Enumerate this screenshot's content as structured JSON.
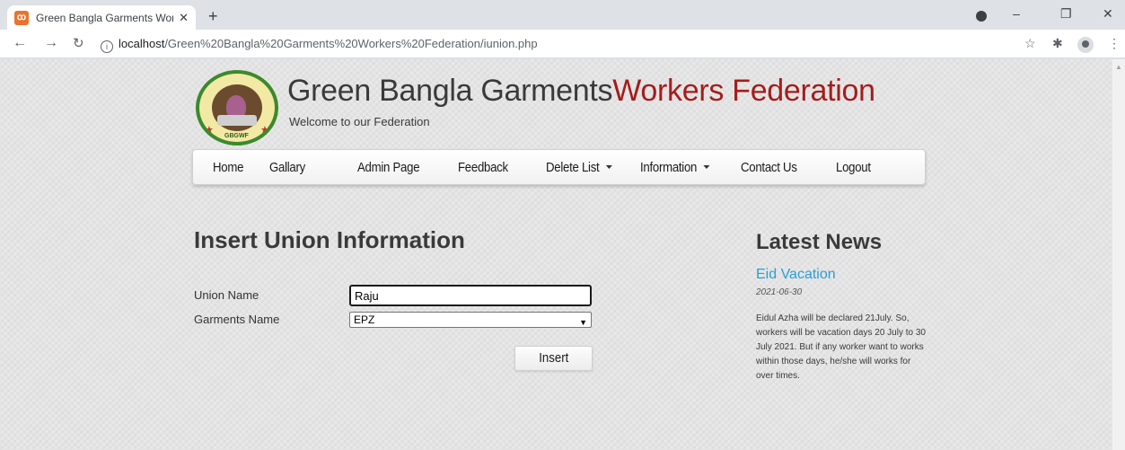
{
  "browser": {
    "tab_title": "Green Bangla Garments Workers",
    "tab_favicon": "XAMPP",
    "new_tab_label": "+",
    "url_host": "localhost",
    "url_path": "/Green%20Bangla%20Garments%20Workers%20Federation/iunion.php",
    "window_controls": {
      "minimize": "–",
      "restore": "❐",
      "close": "✕"
    },
    "icons": [
      "back-icon",
      "forward-icon",
      "reload-icon",
      "info-icon",
      "star-icon",
      "extensions-icon",
      "profile-icon",
      "menu-icon"
    ]
  },
  "header": {
    "logo_text": "GBGWF",
    "title_main": "Green Bangla Garments",
    "title_accent": "Workers Federation",
    "tagline": "Welcome to our Federation"
  },
  "nav": {
    "items": [
      {
        "label": "Home"
      },
      {
        "label": "Gallary"
      },
      {
        "label": "Admin Page"
      },
      {
        "label": "Feedback"
      },
      {
        "label": "Delete List",
        "dropdown": true
      },
      {
        "label": "Information",
        "dropdown": true
      },
      {
        "label": "Contact Us"
      },
      {
        "label": "Logout"
      }
    ]
  },
  "form": {
    "heading": "Insert Union Information",
    "union_name_label": "Union Name",
    "union_name_value": "Raju",
    "garments_name_label": "Garments Name",
    "garments_name_selected": "EPZ",
    "submit_label": "Insert"
  },
  "sidebar": {
    "heading": "Latest News",
    "news_title": "Eid Vacation",
    "news_date": "2021-06-30",
    "news_body": "Eidul Azha will be declared 21July. So, workers will be vacation days 20 July to 30 July 2021. But if any worker want to works within those days, he/she will works for over times."
  },
  "colors": {
    "accent_red": "#a51c1c",
    "link_blue": "#2a9fd6",
    "logo_green": "#3b8a2c"
  }
}
